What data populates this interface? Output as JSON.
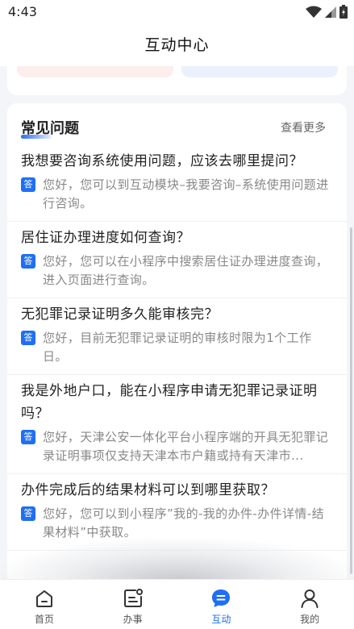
{
  "status_bar": {
    "time": "4:43"
  },
  "header": {
    "title": "互动中心"
  },
  "faq": {
    "title": "常见问题",
    "more_label": "查看更多",
    "answer_badge": "答",
    "items": [
      {
        "question": "我想要咨询系统使用问题，应该去哪里提问？",
        "answer": "您好，您可以到互动模块–我要咨询–系统使用问题进行咨询。"
      },
      {
        "question": "居住证办理进度如何查询？",
        "answer": "您好，您可以在小程序中搜索居住证办理进度查询，进入页面进行查询。"
      },
      {
        "question": "无犯罪记录证明多久能审核完？",
        "answer": "您好，目前无犯罪记录证明的审核时限为1个工作日。"
      },
      {
        "question": "我是外地户口，能在小程序申请无犯罪记录证明吗？",
        "answer": "您好，天津公安一体化平台小程序端的开具无犯罪记录证明事项仅支持天津本市户籍或持有天津市..."
      },
      {
        "question": "办件完成后的结果材料可以到哪里获取？",
        "answer": "您好，您可以到小程序”我的-我的办件-办件详情-结果材料”中获取。"
      }
    ]
  },
  "tabs": [
    {
      "label": "首页",
      "icon": "home-icon"
    },
    {
      "label": "办事",
      "icon": "task-icon"
    },
    {
      "label": "互动",
      "icon": "chat-icon"
    },
    {
      "label": "我的",
      "icon": "person-icon"
    }
  ],
  "colors": {
    "accent": "#1f6ef5",
    "background": "#f3f5f9"
  }
}
